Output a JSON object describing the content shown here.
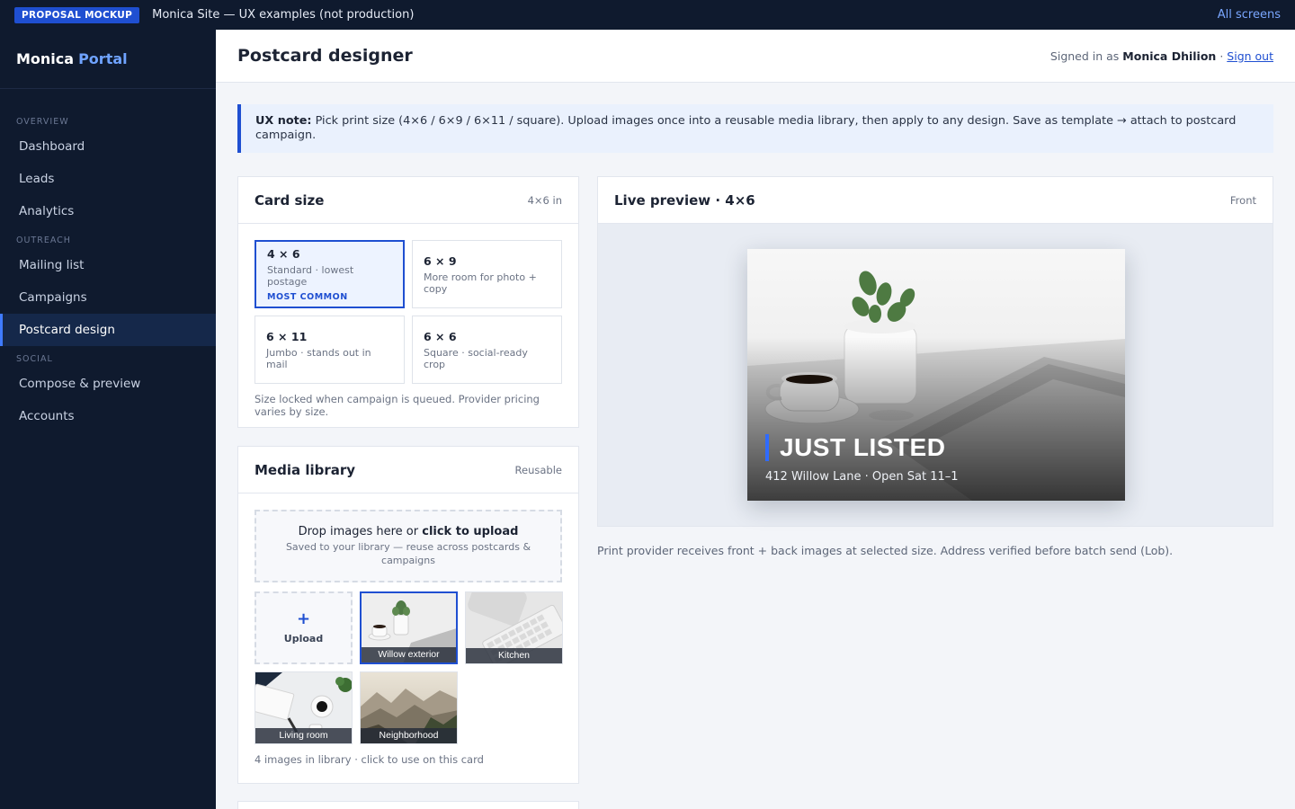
{
  "banner": {
    "badge": "PROPOSAL MOCKUP",
    "title": "Monica Site — UX examples (not production)",
    "link": "All screens"
  },
  "brand": {
    "name": "Monica",
    "accent": "Portal"
  },
  "nav": {
    "sections": [
      {
        "label": "OVERVIEW",
        "items": [
          "Dashboard",
          "Leads",
          "Analytics"
        ]
      },
      {
        "label": "OUTREACH",
        "items": [
          "Mailing list",
          "Campaigns",
          "Postcard design"
        ]
      },
      {
        "label": "SOCIAL",
        "items": [
          "Compose & preview",
          "Accounts"
        ]
      }
    ],
    "active": "Postcard design"
  },
  "header": {
    "title": "Postcard designer",
    "signed_prefix": "Signed in as",
    "user": "Monica Dhilion",
    "separator": "·",
    "sign_out": "Sign out"
  },
  "note": {
    "label": "UX note:",
    "text": "Pick print size (4×6 / 6×9 / 6×11 / square). Upload images once into a reusable media library, then apply to any design. Save as template → attach to postcard campaign."
  },
  "card_size": {
    "title": "Card size",
    "meta": "4×6 in",
    "options": [
      {
        "name": "4 × 6",
        "desc": "Standard · lowest postage",
        "tag": "MOST COMMON",
        "selected": true
      },
      {
        "name": "6 × 9",
        "desc": "More room for photo + copy",
        "tag": "",
        "selected": false
      },
      {
        "name": "6 × 11",
        "desc": "Jumbo · stands out in mail",
        "tag": "",
        "selected": false
      },
      {
        "name": "6 × 6",
        "desc": "Square · social-ready crop",
        "tag": "",
        "selected": false
      }
    ],
    "footnote": "Size locked when campaign is queued. Provider pricing varies by size."
  },
  "media": {
    "title": "Media library",
    "meta": "Reusable",
    "drop_prefix": "Drop images here or",
    "drop_action": "click to upload",
    "drop_sub": "Saved to your library — reuse across postcards & campaigns",
    "upload_label": "Upload",
    "images": [
      "Willow exterior",
      "Kitchen",
      "Living room",
      "Neighborhood"
    ],
    "selected": "Willow exterior",
    "footnote": "4 images in library · click to use on this card"
  },
  "preview": {
    "title": "Live preview · 4×6",
    "meta": "Front",
    "headline": "JUST LISTED",
    "subline": "412 Willow Lane · Open Sat 11–1",
    "footnote": "Print provider receives front + back images at selected size. Address verified before batch send (Lob)."
  },
  "colors": {
    "primary": "#1f4fd1",
    "sidebar": "#0f1a2e",
    "accent": "#6fa3ff"
  }
}
